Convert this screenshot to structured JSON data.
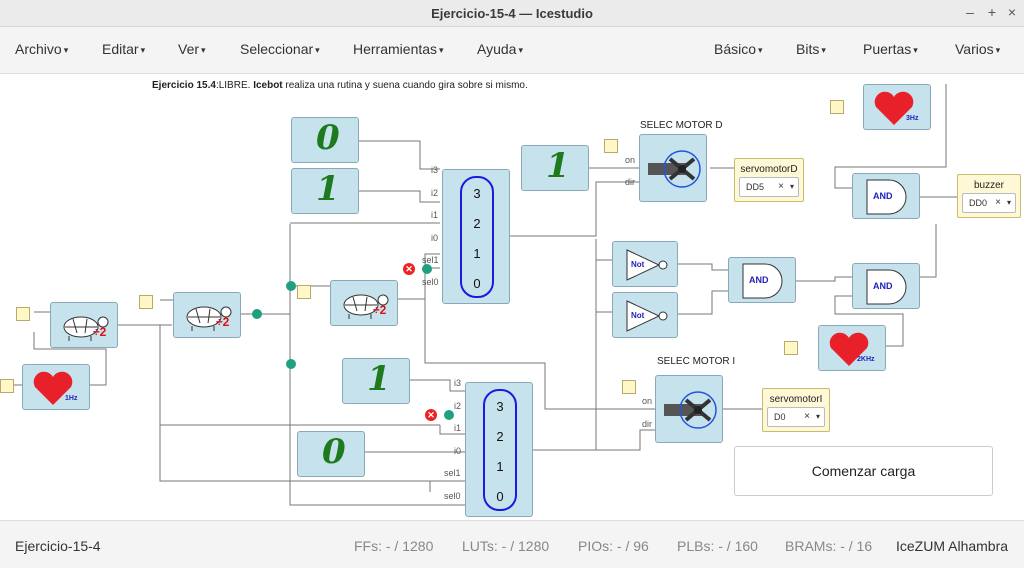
{
  "window": {
    "title": "Ejercicio-15-4 — Icestudio",
    "btn_min": "–",
    "btn_max": "+",
    "btn_close": "×"
  },
  "menu_left": [
    "Archivo",
    "Editar",
    "Ver",
    "Seleccionar",
    "Herramientas",
    "Ayuda"
  ],
  "menu_right": [
    "Básico",
    "Bits",
    "Puertas",
    "Varios"
  ],
  "description": {
    "bold1": "Ejercicio 15.4",
    "text1": ":LIBRE. ",
    "bold2": "Icebot",
    "text2": " realiza una rutina y suena cuando gira sobre si mismo."
  },
  "blocks": {
    "const_top_0": "0",
    "const_top_1": "1",
    "const_on_d": "1",
    "const_mid_1": "1",
    "const_bot_0": "0",
    "mux_top_values": [
      "3",
      "2",
      "1",
      "0"
    ],
    "mux_bot_values": [
      "3",
      "2",
      "1",
      "0"
    ],
    "mux_top_ports": [
      "i3",
      "i2",
      "i1",
      "i0",
      "sel1",
      "sel0"
    ],
    "mux_bot_ports": [
      "i3",
      "i2",
      "i1",
      "i0",
      "sel1",
      "sel0"
    ],
    "div_label": "÷2",
    "heart_1hz": "1Hz",
    "heart_3hz": "3Hz",
    "heart_2khz": "2KHz",
    "not_label": "Not",
    "and_label": "AND",
    "servo_d_title": "SELEC MOTOR D",
    "servo_i_title": "SELEC MOTOR I",
    "servo_ports": [
      "on",
      "dir"
    ],
    "servomotorD": {
      "name": "servomotorD",
      "value": "DD5"
    },
    "servomotorI": {
      "name": "servomotorI",
      "value": "D0"
    },
    "buzzer": {
      "name": "buzzer",
      "value": "DD0"
    }
  },
  "load_button": "Comenzar carga",
  "status": {
    "project": "Ejercicio-15-4",
    "ffs": "FFs:  - / 1280",
    "luts": "LUTs:  - / 1280",
    "pios": "PIOs:  - / 96",
    "plbs": "PLBs:  - / 160",
    "brams": "BRAMs:  - / 16",
    "board": "IceZUM Alhambra"
  },
  "colors": {
    "block_bg": "#c6e2ed",
    "mux_border": "#1a1ae0",
    "wire_dot": "#20a080",
    "heart": "#e8202a",
    "const_green": "#1d7a1d"
  }
}
